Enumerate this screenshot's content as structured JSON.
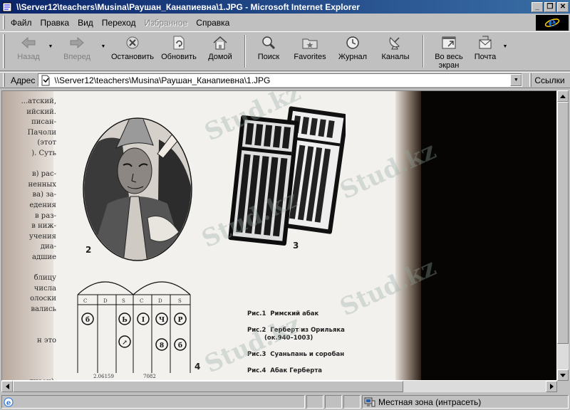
{
  "window": {
    "title": "\\\\Server12\\teachers\\Musina\\Раушан_Канапиевна\\1.JPG - Microsoft Internet Explorer",
    "minimize_glyph": "_",
    "maximize_glyph": "❐",
    "close_glyph": "✕"
  },
  "menu": {
    "items": [
      "Файл",
      "Правка",
      "Вид",
      "Переход",
      "Избранное",
      "Справка"
    ]
  },
  "toolbar": {
    "back": "Назад",
    "forward": "Вперед",
    "stop": "Остановить",
    "refresh": "Обновить",
    "home": "Домой",
    "search": "Поиск",
    "favorites": "Favorites",
    "history": "Журнал",
    "channels": "Каналы",
    "fullscreen_line1": "Во весь",
    "fullscreen_line2": "экран",
    "mail": "Почта"
  },
  "address": {
    "label": "Адрес",
    "value": "\\\\Server12\\teachers\\Musina\\Раушан_Канапиевна\\1.JPG",
    "links_label": "Ссылки"
  },
  "document": {
    "left_column": "...атский,\nийский.\nписан-\nПачоли\n(этот\n). Суть\n\nв) рас-\nненных\nва) за-\nедения\nв раз-\nв ниж-\nучения\nдиа-\nадшие\n\nблицу\nчисла\nолоски\nвались\n\n\nн это\n\n\n\nлизон),",
    "captions": [
      "Рис.1  Римский абак",
      "Рис.2  Герберт из Орильяка",
      "(ок.940–1003)",
      "Рис.3  Суаньпань и соробан",
      "Рис.4  Абак Герберта"
    ],
    "fig_labels": [
      "2",
      "3",
      "4"
    ],
    "column_letters": [
      "C",
      "D",
      "S",
      "C",
      "D",
      "S"
    ],
    "bottom_numbers": [
      "2.06159",
      "7082"
    ],
    "watermark": "Stud.kz"
  },
  "status": {
    "main_text": "",
    "zone": "Местная зона (интрасеть)"
  },
  "colors": {
    "title_start": "#0a246a",
    "title_end": "#3a6ea5",
    "chrome": "#c0c0c0"
  }
}
